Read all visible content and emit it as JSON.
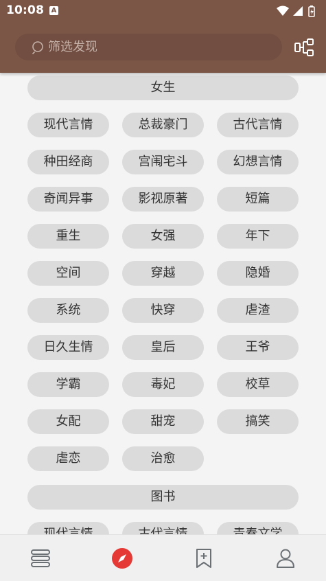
{
  "status_bar": {
    "time": "10:08",
    "notification_glyph": "A"
  },
  "search": {
    "placeholder": "筛选发现"
  },
  "sections": [
    {
      "title": "女生",
      "tags": [
        "现代言情",
        "总裁豪门",
        "古代言情",
        "种田经商",
        "宫闱宅斗",
        "幻想言情",
        "奇闻异事",
        "影视原著",
        "短篇",
        "重生",
        "女强",
        "年下",
        "空间",
        "穿越",
        "隐婚",
        "系统",
        "快穿",
        "虐渣",
        "日久生情",
        "皇后",
        "王爷",
        "学霸",
        "毒妃",
        "校草",
        "女配",
        "甜宠",
        "搞笑",
        "虐恋",
        "治愈"
      ]
    },
    {
      "title": "图书",
      "tags": [
        "现代言情",
        "古代言情",
        "青春文学"
      ]
    }
  ],
  "bottom_nav": [
    {
      "name": "bookshelf",
      "icon": "books-icon",
      "active": false
    },
    {
      "name": "discover",
      "icon": "compass-icon",
      "active": true
    },
    {
      "name": "bookmarks",
      "icon": "bookmark-add-icon",
      "active": false
    },
    {
      "name": "profile",
      "icon": "person-icon",
      "active": false
    }
  ],
  "colors": {
    "topbar": "#7b5647",
    "search_box": "#714e41",
    "chip": "#dbdbdb",
    "background": "#f4f4f4",
    "accent": "#e53935",
    "nav_icon": "#6b7075"
  }
}
